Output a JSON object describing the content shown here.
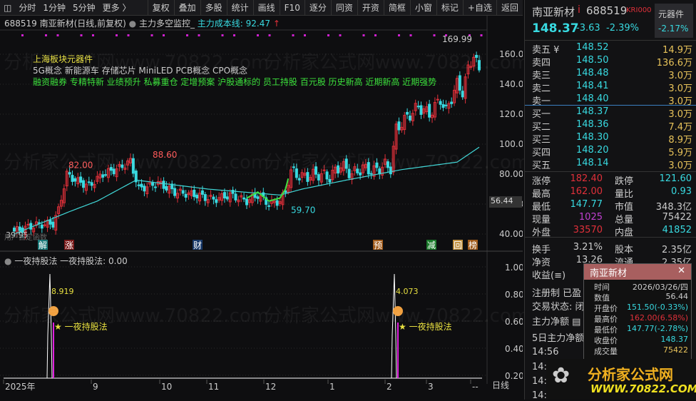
{
  "toolbar": {
    "left": [
      "分时",
      "1分钟",
      "5分钟",
      "更多 〉"
    ],
    "right": [
      "复权",
      "叠加",
      "多股",
      "统计",
      "画线",
      "F10",
      "逐分",
      "同资",
      "开资",
      "简框",
      "小窗",
      "标记",
      "+自选",
      "返回"
    ]
  },
  "chart_header": {
    "title": "688519 南亚新材(日线,前复权)",
    "indicator": "主力多空监控_",
    "cost_label": "主力成本线: 92.47",
    "arrow": "↑"
  },
  "info": {
    "sector": "上海板块元器件",
    "concepts": "5G概念 新能源车 存储芯片 MiniLED PCB概念 CPO概念",
    "tags": "融资融券 专精特新 业绩预升 私募重仓 定增预案 沪股通标的 员工持股 百元股 历史新高 近期新高 近期强势"
  },
  "price_axis": [
    "160.00",
    "140.00",
    "120.00",
    "100.00",
    "80.00",
    "60.00",
    "40.00"
  ],
  "price_labels": {
    "high": "169.99",
    "p82": "82.00",
    "p88": "88.60",
    "low": "59.70",
    "start": "39.95",
    "current": "56.44",
    "func": "用户自定函数"
  },
  "event_markers": [
    "解",
    "涨",
    "财",
    "预",
    "减",
    "回",
    "榜"
  ],
  "lower": {
    "title": "一夜持股法",
    "value_label": "一夜持股法: 0.00",
    "axis": [
      "1.00",
      "0.80",
      "0.60",
      "0.40",
      "0.20"
    ],
    "sig1": "8.919",
    "sig2": "4.073",
    "sig_label": "★ 一夜持股法"
  },
  "time_axis": [
    "2025年",
    "9",
    "10",
    "11",
    "12",
    "1",
    "2",
    "3",
    "--"
  ],
  "period": "日线",
  "watermark": "分析家公式网www.70822.com",
  "chart_data": {
    "type": "candlestick",
    "path": [
      [
        0,
        42
      ],
      [
        8,
        46
      ],
      [
        14,
        47
      ],
      [
        16,
        56
      ],
      [
        19,
        80
      ],
      [
        22,
        76
      ],
      [
        27,
        72
      ],
      [
        32,
        80
      ],
      [
        38,
        84
      ],
      [
        42,
        88.6
      ],
      [
        45,
        70
      ],
      [
        52,
        74
      ],
      [
        58,
        68
      ],
      [
        66,
        66
      ],
      [
        72,
        63
      ],
      [
        78,
        66
      ],
      [
        84,
        62
      ],
      [
        88,
        66
      ],
      [
        92,
        60
      ],
      [
        96,
        62
      ],
      [
        98,
        68
      ],
      [
        100,
        82
      ],
      [
        104,
        78
      ],
      [
        110,
        80
      ],
      [
        114,
        78
      ],
      [
        118,
        86
      ],
      [
        122,
        80
      ],
      [
        126,
        84
      ],
      [
        130,
        82
      ],
      [
        134,
        86
      ],
      [
        136,
        84
      ],
      [
        138,
        110
      ],
      [
        142,
        118
      ],
      [
        146,
        125
      ],
      [
        150,
        120
      ],
      [
        154,
        130
      ],
      [
        156,
        122
      ],
      [
        160,
        140
      ],
      [
        162,
        135
      ],
      [
        164,
        150
      ],
      [
        166,
        160
      ],
      [
        168,
        148.37
      ]
    ],
    "cost_line": [
      [
        0,
        40
      ],
      [
        20,
        55
      ],
      [
        30,
        62
      ],
      [
        44,
        76
      ],
      [
        70,
        70
      ],
      [
        96,
        66
      ],
      [
        104,
        70
      ],
      [
        120,
        76
      ],
      [
        140,
        83
      ],
      [
        160,
        88
      ],
      [
        168,
        98
      ]
    ],
    "signals": [
      12,
      140
    ]
  },
  "quote": {
    "name": "南亚新材",
    "flag": "i",
    "code": "688519",
    "kr": "KRI000",
    "sector": "元器件",
    "sector_chg": "-2.17%",
    "price": "148.37",
    "chg": "-3.63",
    "pct": "-2.39%"
  },
  "asks": [
    [
      "卖五 ¥",
      "148.52",
      "14.9万"
    ],
    [
      "卖四",
      "148.50",
      "136.6万"
    ],
    [
      "卖三",
      "148.48",
      "3.0万"
    ],
    [
      "卖二",
      "148.41",
      "3.0万"
    ],
    [
      "卖一",
      "148.40",
      "3.0万"
    ]
  ],
  "bids": [
    [
      "买一",
      "148.37",
      "3.0万"
    ],
    [
      "买二",
      "148.36",
      "7.4万"
    ],
    [
      "买三",
      "148.30",
      "8.9万"
    ],
    [
      "买四",
      "148.20",
      "5.9万"
    ],
    [
      "买五",
      "148.14",
      "3.0万"
    ]
  ],
  "stats": [
    [
      "涨停",
      "182.40",
      "跌停",
      "121.60"
    ],
    [
      "最高",
      "162.00",
      "量比",
      "0.93"
    ],
    [
      "最低",
      "147.77",
      "市值",
      "348.3亿"
    ],
    [
      "现量",
      "1025",
      "总量",
      "75422"
    ],
    [
      "外盘",
      "33570",
      "内盘",
      "41852"
    ],
    [
      "换手",
      "3.21%",
      "股本",
      "2.35亿"
    ],
    [
      "净资",
      "13.26",
      "流通",
      "2.35亿"
    ],
    [
      "收益(≡)",
      "",
      ""
    ]
  ],
  "misc": [
    "注册制 已盈",
    "交易状态: 闭",
    "主力净额 ▤",
    "5日主力净额"
  ],
  "ticks": [
    "14:56",
    "14:5",
    "14:5",
    "14:5"
  ],
  "popup": {
    "title": "南亚新材",
    "close": "✕",
    "rows": [
      [
        "时间",
        "2026/03/26/四"
      ],
      [
        "数值",
        "56.44"
      ],
      [
        "开盘价",
        "151.50(-0.33%)"
      ],
      [
        "最高价",
        "162.00(6.58%)"
      ],
      [
        "最低价",
        "147.77(-2.78%)"
      ],
      [
        "收盘价",
        "148.37"
      ],
      [
        "成交量",
        "75422"
      ]
    ]
  },
  "logo": {
    "text": "分析家公式网",
    "url": "WWW.70822.COM"
  }
}
